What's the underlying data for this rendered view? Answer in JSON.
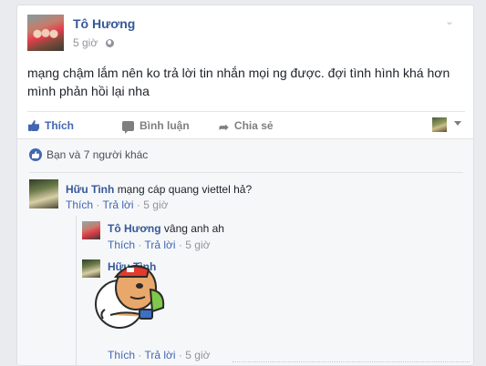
{
  "post": {
    "author": "Tô Hương",
    "time": "5 giờ",
    "text": "mạng chậm lắm nên ko trả lời tin nhắn mọi ng được. đợi tình hình khá hơn mình phản hồi lại nha",
    "menu_icon": "chevron-down-icon",
    "privacy_icon": "globe-icon"
  },
  "actions": {
    "like": "Thích",
    "comment": "Bình luận",
    "share": "Chia sẻ"
  },
  "reactions": {
    "summary": "Bạn và 7 người khác"
  },
  "comments": [
    {
      "author": "Hữu Tình",
      "text": "mạng cáp quang viettel hả?",
      "like": "Thích",
      "reply": "Trả lời",
      "dot": "·",
      "time": "5 giờ"
    }
  ],
  "replies": [
    {
      "author": "Tô Hương",
      "text": "vâng anh ah",
      "like": "Thích",
      "reply": "Trả lời",
      "dot": "·",
      "time": "5 giờ"
    },
    {
      "author": "Hữu Tình",
      "text": "",
      "sticker": "hug-sticker",
      "like": "Thích",
      "reply": "Trả lời",
      "dot": "·",
      "time": "5 giờ"
    }
  ],
  "colors": {
    "link": "#365899",
    "accent": "#4267b2",
    "muted": "#90949c",
    "background": "#e9ebee"
  }
}
